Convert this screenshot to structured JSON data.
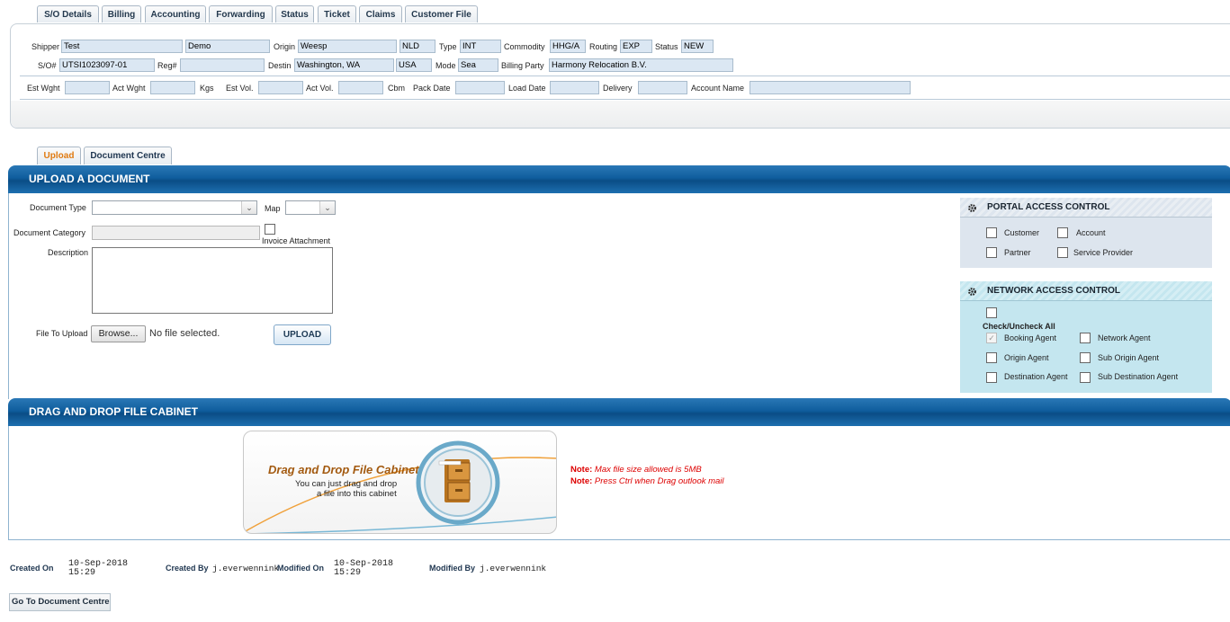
{
  "tabs": [
    "S/O Details",
    "Billing",
    "Accounting",
    "Forwarding",
    "Status",
    "Ticket",
    "Claims",
    "Customer File"
  ],
  "header": {
    "shipper_label": "Shipper",
    "shipper": "Test",
    "shipper2": "Demo",
    "origin_label": "Origin",
    "origin": "Weesp",
    "origin_country": "NLD",
    "type_label": "Type",
    "type": "INT",
    "commodity_label": "Commodity",
    "commodity": "HHG/A",
    "routing_label": "Routing",
    "routing": "EXP",
    "status_label": "Status",
    "status": "NEW",
    "so_label": "S/O#",
    "so": "UTSI1023097-01",
    "reg_label": "Reg#",
    "reg": "",
    "destin_label": "Destin",
    "destin": "Washington, WA",
    "destin_country": "USA",
    "mode_label": "Mode",
    "mode": "Sea",
    "billing_label": "Billing Party",
    "billing": "Harmony Relocation B.V.",
    "est_wght_label": "Est Wght",
    "est_wght": "",
    "act_wght_label": "Act Wght",
    "act_wght": "",
    "kgs": "Kgs",
    "est_vol_label": "Est Vol.",
    "est_vol": "",
    "act_vol_label": "Act Vol.",
    "act_vol": "",
    "cbm": "Cbm",
    "pack_date_label": "Pack Date",
    "pack_date": "",
    "load_date_label": "Load Date",
    "load_date": "",
    "delivery_label": "Delivery",
    "delivery": "",
    "account_name_label": "Account Name",
    "account_name": ""
  },
  "subtabs": [
    "Upload",
    "Document Centre"
  ],
  "upload": {
    "title": "UPLOAD A DOCUMENT",
    "doc_type_label": "Document Type",
    "doc_type": "",
    "map_label": "Map",
    "map": "",
    "doc_category_label": "Document Category",
    "doc_category": "",
    "invoice_attachment_label": "Invoice Attachment",
    "description_label": "Description",
    "description": "",
    "file_label": "File To Upload",
    "browse": "Browse...",
    "no_file": "No file selected.",
    "upload_btn": "UPLOAD"
  },
  "portal": {
    "title": "PORTAL ACCESS CONTROL",
    "customer": "Customer",
    "account": "Account",
    "partner": "Partner",
    "service_provider": "Service Provider"
  },
  "network": {
    "title": "NETWORK ACCESS CONTROL",
    "check_all": "Check/Uncheck All",
    "booking_agent": "Booking Agent",
    "network_agent": "Network Agent",
    "origin_agent": "Origin Agent",
    "sub_origin_agent": "Sub Origin Agent",
    "destination_agent": "Destination Agent",
    "sub_destination_agent": "Sub Destination Agent"
  },
  "cabinet": {
    "title": "DRAG AND DROP FILE CABINET",
    "heading": "Drag and Drop File Cabinet",
    "line1": "You can just drag and drop",
    "line2": "a file into this cabinet",
    "note_label": "Note:",
    "note1": "Max file size allowed is 5MB",
    "note2": "Press Ctrl when Drag outlook mail"
  },
  "footer": {
    "created_on_label": "Created On",
    "created_on_date": "10-Sep-2018",
    "created_on_time": "15:29",
    "created_by_label": "Created By",
    "created_by": "j.everwennink",
    "modified_on_label": "Modified On",
    "modified_on_date": "10-Sep-2018",
    "modified_on_time": "15:29",
    "modified_by_label": "Modified By",
    "modified_by": "j.everwennink",
    "go_btn": "Go To Document Centre"
  },
  "colors": {
    "banner": "#0f5d9d",
    "note": "#dd0000",
    "upload_tab": "#e07a10"
  }
}
